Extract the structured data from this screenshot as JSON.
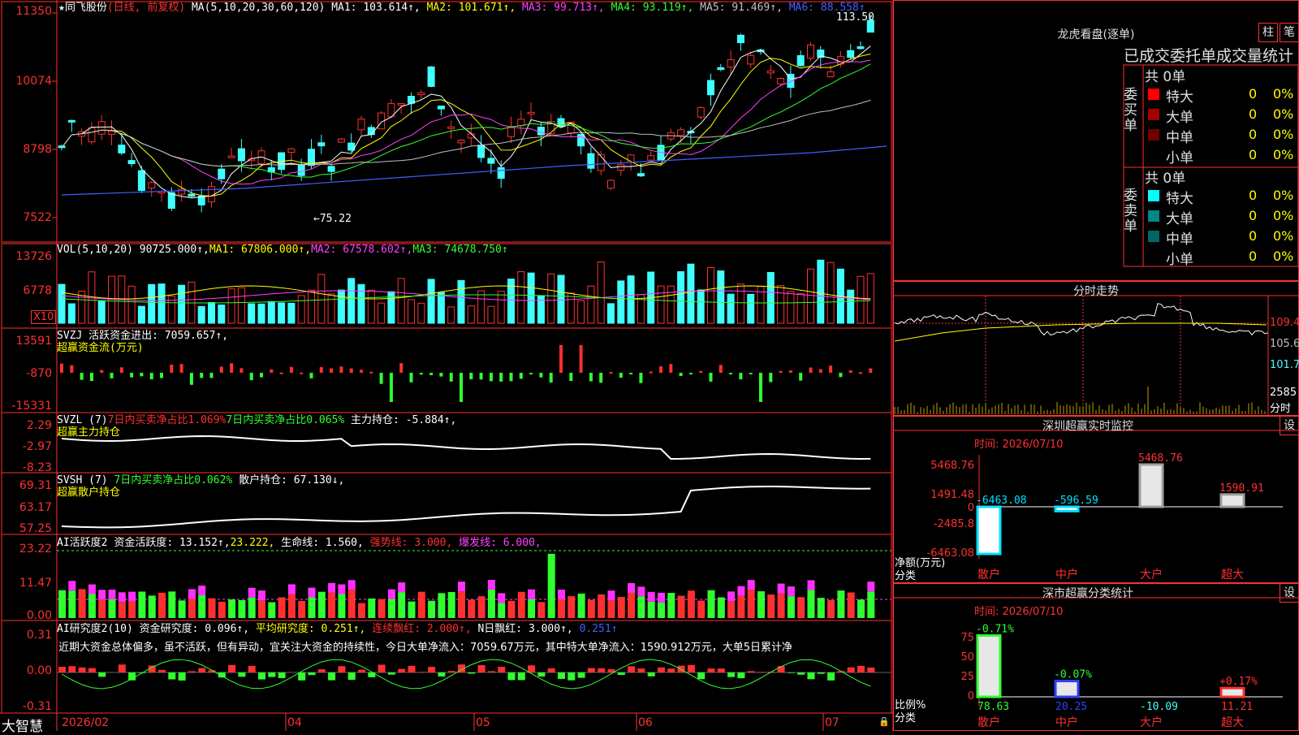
{
  "header": {
    "star": "★",
    "stock_name": "同飞股份",
    "period": "(日线, 前复权)",
    "ma_params": "MA(5,10,20,30,60,120)",
    "ma_values": [
      {
        "label": "MA1: 103.614↑,",
        "color": "#ffffff"
      },
      {
        "label": "MA2: 101.671↑,",
        "color": "#ffff00"
      },
      {
        "label": "MA3: 99.713↑,",
        "color": "#ff40ff"
      },
      {
        "label": "MA4: 93.119↑,",
        "color": "#30ff30"
      },
      {
        "label": "MA5: 91.469↑,",
        "color": "#c0c0c0"
      },
      {
        "label": "MA6: 88.558↑",
        "color": "#4060ff"
      }
    ],
    "high_marker": "113.50",
    "low_marker": "75.22"
  },
  "price_axis": [
    "11350",
    "10074",
    "8798",
    "7522"
  ],
  "vol": {
    "title": "VOL(5,10,20)",
    "value": "90725.000↑,",
    "ma1": "MA1: 67806.000↑,",
    "ma2": "MA2: 67578.602↑,",
    "ma3": "MA3: 74678.750↑",
    "axis": [
      "13726",
      "6778"
    ],
    "unit": "X10"
  },
  "svzj": {
    "title": "SVZJ",
    "label": "活跃资金进出: 7059.657↑,",
    "sub": "超赢资金流(万元)",
    "axis": [
      "13591",
      "-870",
      "-15331"
    ]
  },
  "svzl": {
    "title": "SVZL (7)",
    "a": "7日内买卖净占比1.069%",
    "b": "7日内买卖净占比0.065%",
    "c": "主力持仓: -5.884↑,",
    "sub": "超赢主力持仓",
    "axis": [
      "2.29",
      "-2.97",
      "-8.23"
    ]
  },
  "svsh": {
    "title": "SVSH (7)",
    "a": "7日内买卖净占比0.062%",
    "b": "散户持仓: 67.130↓,",
    "sub": "超赢散户持仓",
    "axis": [
      "69.31",
      "63.17",
      "57.25"
    ]
  },
  "ai1": {
    "title": "AI活跃度2",
    "a": "资金活跃度: 13.152↑,",
    "b": "23.222,",
    "c": "生命线: 1.560,",
    "d": "强势线: 3.000,",
    "e": "爆发线: 6.000,",
    "axis": [
      "23.22",
      "11.47",
      "0.00"
    ]
  },
  "ai2": {
    "title": "AI研究度2(10)",
    "a": "资金研究度: 0.096↑,",
    "b": "平均研究度: 0.251↑,",
    "c": "连续飘红: 2.000↑,",
    "d": "N日飘红: 3.000↑,",
    "e": "0.251↑",
    "comment": "近期大资金总体偏多，虽不活跃，但有异动，宜关注大资金的持续性，今日大单净流入：7059.67万元，其中特大单净流入：1590.912万元，大单5日累计净",
    "axis": [
      "0.31",
      "0.00",
      "-0.31"
    ]
  },
  "x_axis": [
    "2026/02",
    "04",
    "05",
    "06",
    "07"
  ],
  "brand": "大智慧",
  "right": {
    "lhb_title": "龙虎看盘(逐单)",
    "btn_bar": "柱",
    "btn_tick": "笔",
    "stats_title": "已成交委托单成交量统计",
    "buy_side": "委买单",
    "sell_side": "委卖单",
    "buy_total": "共 0单",
    "sell_total": "共 0单",
    "buy_rows": [
      {
        "name": "特大",
        "count": "0",
        "pct": "0%",
        "color": "#ff0000"
      },
      {
        "name": "大单",
        "count": "0",
        "pct": "0%",
        "color": "#a00000"
      },
      {
        "name": "中单",
        "count": "0",
        "pct": "0%",
        "color": "#700000"
      },
      {
        "name": "小单",
        "count": "0",
        "pct": "0%",
        "color": ""
      }
    ],
    "sell_rows": [
      {
        "name": "特大",
        "count": "0",
        "pct": "0%",
        "color": "#00ffff"
      },
      {
        "name": "大单",
        "count": "0",
        "pct": "0%",
        "color": "#008888"
      },
      {
        "name": "中单",
        "count": "0",
        "pct": "0%",
        "color": "#006666"
      },
      {
        "name": "小单",
        "count": "0",
        "pct": "0%",
        "color": ""
      }
    ],
    "intraday_title": "分时走势",
    "intraday_axis": [
      "109.4",
      "105.6",
      "101.7",
      "2585",
      "分时"
    ],
    "sz_title": "深圳超赢实时监控",
    "sz_btn": "设",
    "sz_time": "时间: 2026/07/10",
    "sz_axis": [
      "5468.76",
      "1491.48",
      "0",
      "-2485.8",
      "-6463.08"
    ],
    "sz_ylabel": "净额(万元)",
    "sz_xlabel": "分类",
    "sm_title": "深市超赢分类统计",
    "sm_btn": "设",
    "sm_time": "时间: 2026/07/10",
    "sm_axis": [
      "75",
      "50",
      "25",
      "0"
    ],
    "sm_ylabel": "比例%",
    "sm_xlabel": "分类"
  },
  "chart_data": [
    {
      "type": "bar",
      "title": "深圳超赢实时监控",
      "categories": [
        "散户",
        "中户",
        "大户",
        "超大"
      ],
      "values": [
        -6463.08,
        -596.59,
        5468.76,
        1590.91
      ],
      "value_labels": [
        "-6463.08",
        "-596.59",
        "5468.76",
        "1590.91"
      ],
      "ylabel": "净额(万元)",
      "xlabel": "分类",
      "ylim": [
        -6463.08,
        5468.76
      ]
    },
    {
      "type": "bar",
      "title": "深市超赢分类统计",
      "categories": [
        "散户",
        "中户",
        "大户",
        "超大"
      ],
      "values": [
        78.63,
        20.25,
        -10.09,
        11.21
      ],
      "value_labels": [
        "78.63",
        "20.25",
        "-10.09",
        "11.21"
      ],
      "change_labels": [
        "-0.71%",
        "-0.07%",
        "",
        "+0.17%"
      ],
      "ylabel": "比例%",
      "xlabel": "分类",
      "ylim": [
        0,
        75
      ]
    }
  ],
  "colors": {
    "up": "#ff3030",
    "down": "#40ffff",
    "frame": "#ff3030"
  }
}
